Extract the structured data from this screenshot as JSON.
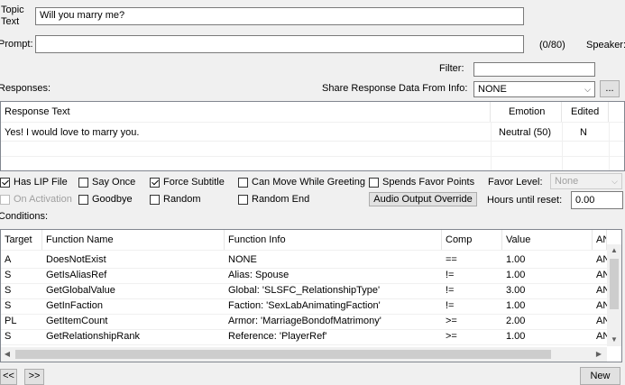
{
  "topic": {
    "label": "Topic\nText",
    "value": "Will you marry me?"
  },
  "prompt": {
    "label": "Prompt:",
    "value": "",
    "count": "(0/80)"
  },
  "speaker_label": "Speaker:",
  "filter": {
    "label": "Filter:",
    "value": ""
  },
  "responses_label": "Responses:",
  "share": {
    "label": "Share Response Data From Info:",
    "value": "NONE",
    "button": "..."
  },
  "responses_table": {
    "headers": [
      "Response Text",
      "Emotion",
      "Edited"
    ],
    "rows": [
      [
        "Yes! I would love to marry you.",
        "Neutral (50)",
        "N"
      ]
    ]
  },
  "options": {
    "has_lip_file": {
      "label": "Has LIP File",
      "checked": true
    },
    "say_once": {
      "label": "Say Once",
      "checked": false
    },
    "force_subtitle": {
      "label": "Force Subtitle",
      "checked": true
    },
    "can_move_while_greeting": {
      "label": "Can Move While Greeting",
      "checked": false
    },
    "spends_favor_points": {
      "label": "Spends Favor Points",
      "checked": false
    },
    "on_activation": {
      "label": "On Activation",
      "checked": false,
      "disabled": true
    },
    "goodbye": {
      "label": "Goodbye",
      "checked": false
    },
    "random": {
      "label": "Random",
      "checked": false
    },
    "random_end": {
      "label": "Random End",
      "checked": false
    }
  },
  "favor_level": {
    "label": "Favor Level:",
    "value": "None"
  },
  "audio_output_override": "Audio Output Override",
  "hours_until_reset": {
    "label": "Hours until reset:",
    "value": "0.00"
  },
  "conditions_label": "Conditions:",
  "conditions_table": {
    "headers": [
      "Target",
      "Function Name",
      "Function Info",
      "Comp",
      "Value",
      "AN"
    ],
    "rows": [
      [
        "A",
        "DoesNotExist",
        "NONE",
        "==",
        "1.00",
        "AN"
      ],
      [
        "S",
        "GetIsAliasRef",
        "Alias: Spouse",
        "!=",
        "1.00",
        "AN"
      ],
      [
        "S",
        "GetGlobalValue",
        "Global: 'SLSFC_RelationshipType'",
        "!=",
        "3.00",
        "AN"
      ],
      [
        "S",
        "GetInFaction",
        "Faction: 'SexLabAnimatingFaction'",
        "!=",
        "1.00",
        "AN"
      ],
      [
        "PL",
        "GetItemCount",
        "Armor: 'MarriageBondofMatrimony'",
        ">=",
        "2.00",
        "AN"
      ],
      [
        "S",
        "GetRelationshipRank",
        "Reference: 'PlayerRef'",
        ">=",
        "1.00",
        "AN"
      ]
    ]
  },
  "nav": {
    "prev": "<<",
    "next": ">>",
    "new": "New"
  }
}
